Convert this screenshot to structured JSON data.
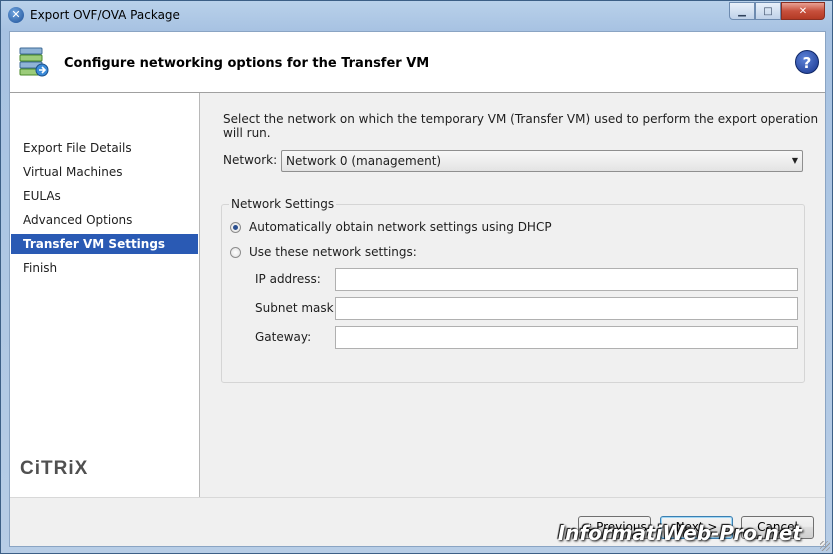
{
  "window": {
    "title": "Export OVF/OVA Package",
    "controls": {
      "minimize": "▁",
      "maximize": "□",
      "close": "✕"
    }
  },
  "header": {
    "title": "Configure networking options for the Transfer VM",
    "help_icon": "?"
  },
  "sidebar": {
    "items": [
      {
        "label": "Export File Details",
        "active": false
      },
      {
        "label": "Virtual Machines",
        "active": false
      },
      {
        "label": "EULAs",
        "active": false
      },
      {
        "label": "Advanced Options",
        "active": false
      },
      {
        "label": "Transfer VM Settings",
        "active": true
      },
      {
        "label": "Finish",
        "active": false
      }
    ],
    "logo": "CiTRiX"
  },
  "main": {
    "description": "Select the network on which the temporary VM (Transfer VM) used to perform the export operation will run.",
    "network_label": "Network:",
    "network_value": "Network 0 (management)",
    "group_title": "Network Settings",
    "radio_dhcp": "Automatically obtain network settings using DHCP",
    "radio_dhcp_checked": true,
    "radio_manual": "Use these network settings:",
    "radio_manual_checked": false,
    "fields": {
      "ip_label": "IP address:",
      "ip_value": "",
      "subnet_label": "Subnet mask:",
      "subnet_value": "",
      "gateway_label": "Gateway:",
      "gateway_value": ""
    }
  },
  "footer": {
    "previous": "< Previous",
    "next": "Next >",
    "cancel": "Cancel"
  },
  "watermark": "InformatiWeb-Pro.net",
  "colors": {
    "selected_nav": "#2a5ab4",
    "titlebar": "#b9d1ea"
  }
}
